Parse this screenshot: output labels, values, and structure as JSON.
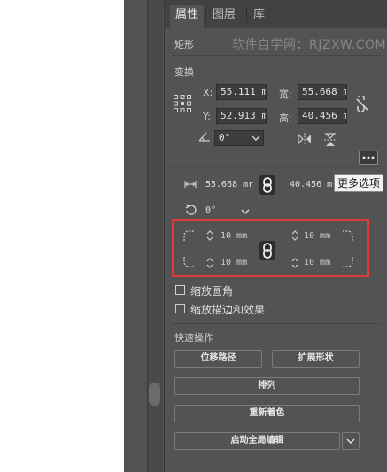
{
  "tabs": [
    {
      "label": "属性",
      "active": true
    },
    {
      "label": "图层",
      "active": false
    },
    {
      "label": "库",
      "active": false
    }
  ],
  "object_type": "矩形",
  "watermark": "软件自学网：RJZXW.COM",
  "transform": {
    "heading": "变换",
    "x_label": "X:",
    "x_value": "55.111 m",
    "y_label": "Y:",
    "y_value": "52.913 m",
    "width_label": "宽:",
    "width_value": "55.668 m",
    "height_label": "高:",
    "height_value": "40.456 m",
    "rotation_value": "0°"
  },
  "more_options_tooltip": "更多选项",
  "shape_popup": {
    "width_value": "55.668 mr",
    "height_value": "40.456 m",
    "rotation_value": "0°",
    "corner_tl": "10 mm",
    "corner_tr": "10 mm",
    "corner_bl": "10 mm",
    "corner_br": "10 mm"
  },
  "options": {
    "scale_corners": "缩放圆角",
    "scale_strokes": "缩放描边和效果"
  },
  "quick_actions": {
    "heading": "快速操作",
    "offset_path": "位移路径",
    "expand_shape": "扩展形状",
    "arrange": "排列",
    "recolor": "重新着色",
    "global_edit": "启动全局编辑"
  },
  "colors": {
    "highlight": "#e03a3a",
    "panel_bg": "#535353"
  }
}
